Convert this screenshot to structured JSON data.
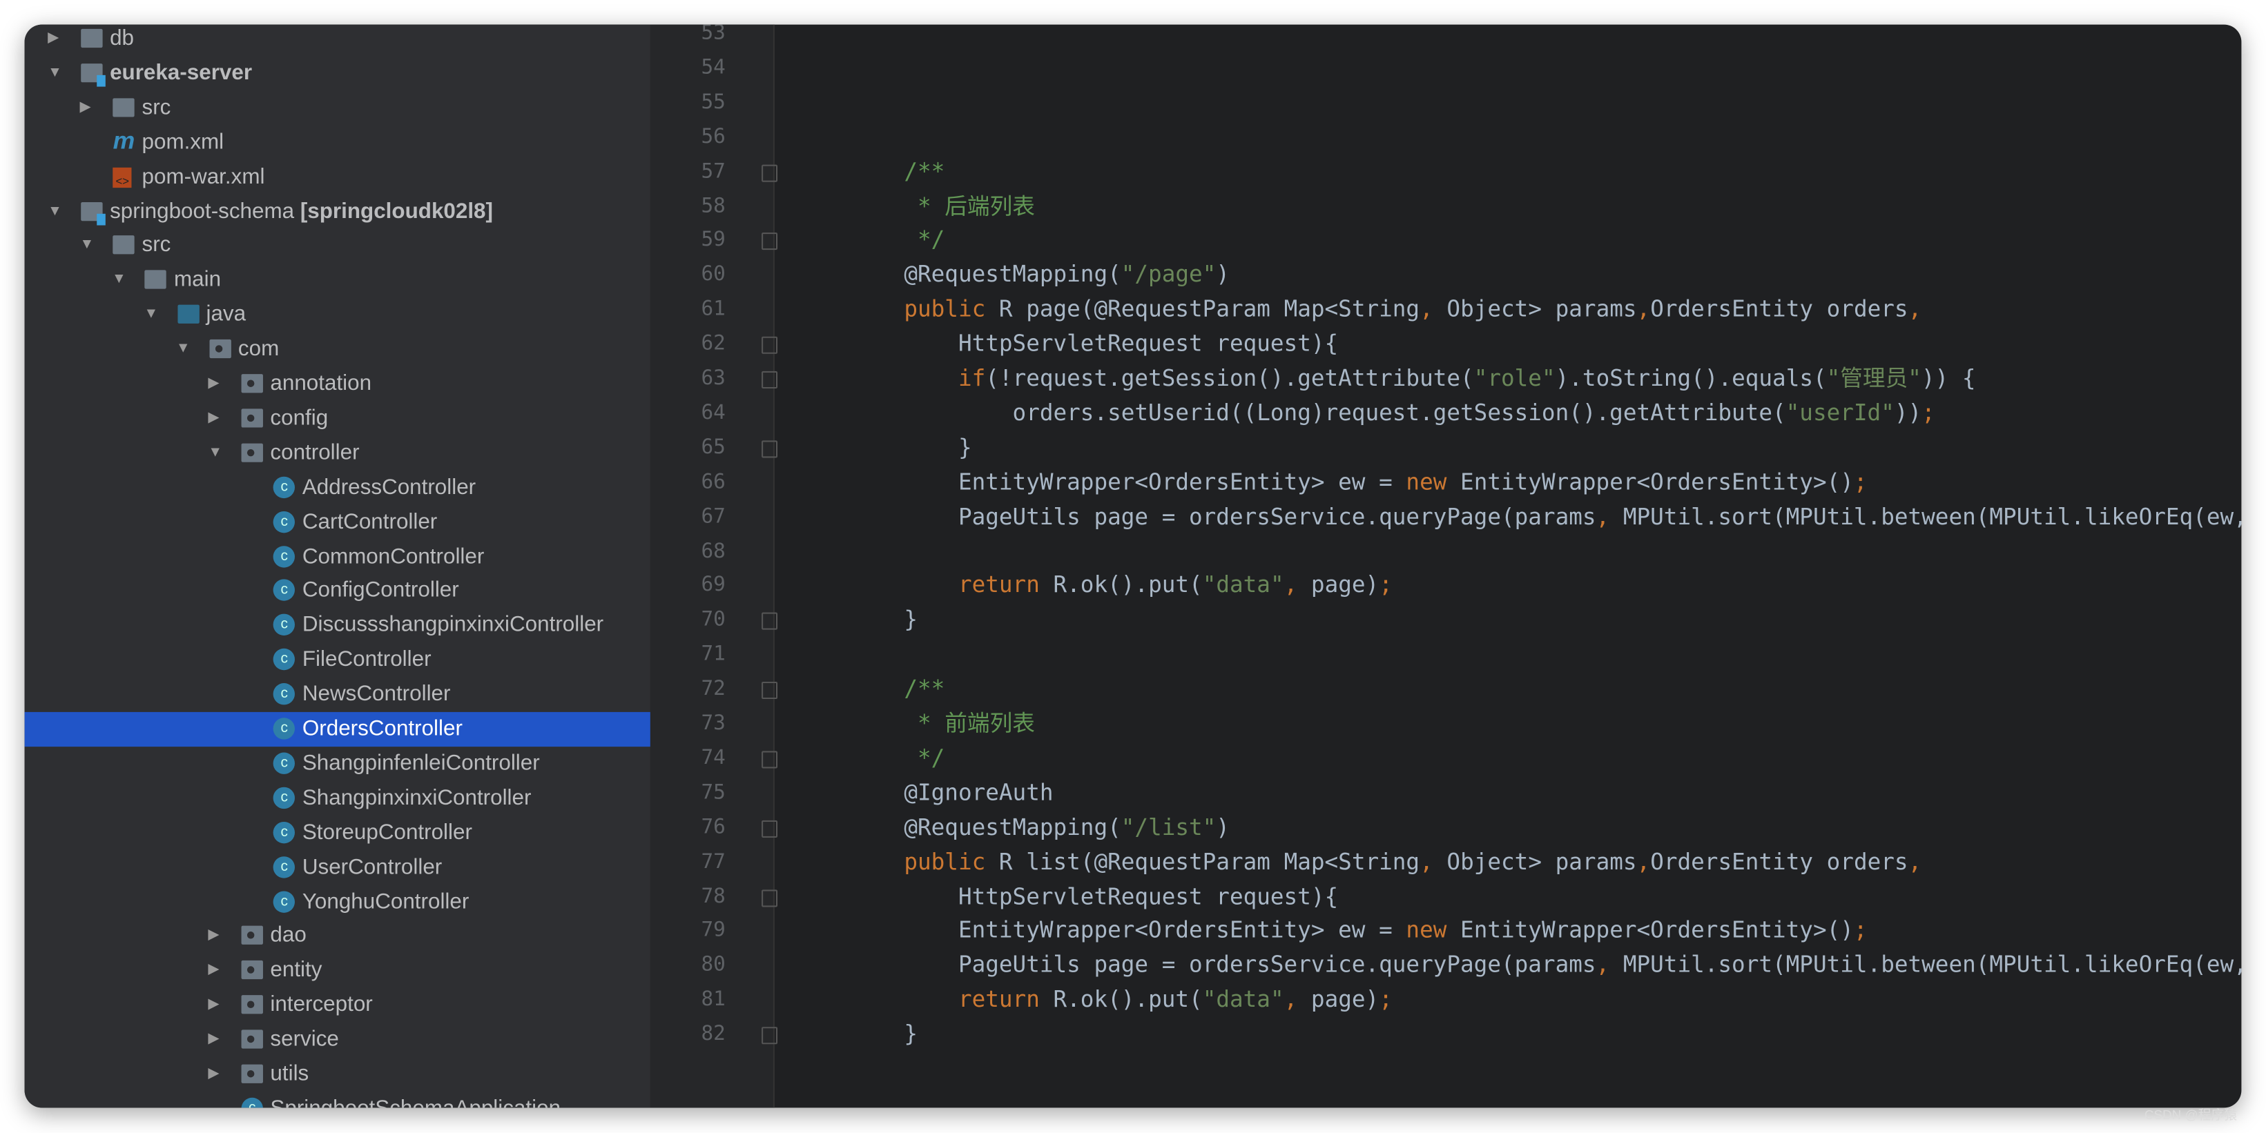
{
  "sidebar": {
    "items": [
      {
        "label": "db",
        "level": 0,
        "arrow": "right",
        "icon": "folder-icon"
      },
      {
        "label": "eureka-server",
        "level": 0,
        "arrow": "down",
        "icon": "module-folder-icon",
        "bold": true
      },
      {
        "label": "src",
        "level": 1,
        "arrow": "right",
        "icon": "folder-icon"
      },
      {
        "label": "pom.xml",
        "level": 1,
        "arrow": "none",
        "icon": "maven-icon"
      },
      {
        "label": "pom-war.xml",
        "level": 1,
        "arrow": "none",
        "icon": "xml-file-icon"
      },
      {
        "label": "springboot-schema",
        "suffix": "[springcloudk02l8]",
        "level": 0,
        "arrow": "down",
        "icon": "module-folder-icon"
      },
      {
        "label": "src",
        "level": 1,
        "arrow": "down",
        "icon": "folder-icon"
      },
      {
        "label": "main",
        "level": 2,
        "arrow": "down",
        "icon": "folder-icon"
      },
      {
        "label": "java",
        "level": 3,
        "arrow": "down",
        "icon": "source-folder-icon"
      },
      {
        "label": "com",
        "level": 4,
        "arrow": "down",
        "icon": "package-icon"
      },
      {
        "label": "annotation",
        "level": 5,
        "arrow": "right",
        "icon": "package-icon"
      },
      {
        "label": "config",
        "level": 5,
        "arrow": "right",
        "icon": "package-icon"
      },
      {
        "label": "controller",
        "level": 5,
        "arrow": "down",
        "icon": "package-icon"
      },
      {
        "label": "AddressController",
        "level": 6,
        "arrow": "none",
        "icon": "class-icon"
      },
      {
        "label": "CartController",
        "level": 6,
        "arrow": "none",
        "icon": "class-icon"
      },
      {
        "label": "CommonController",
        "level": 6,
        "arrow": "none",
        "icon": "class-icon"
      },
      {
        "label": "ConfigController",
        "level": 6,
        "arrow": "none",
        "icon": "class-icon"
      },
      {
        "label": "DiscussshangpinxinxiController",
        "level": 6,
        "arrow": "none",
        "icon": "class-icon"
      },
      {
        "label": "FileController",
        "level": 6,
        "arrow": "none",
        "icon": "class-icon"
      },
      {
        "label": "NewsController",
        "level": 6,
        "arrow": "none",
        "icon": "class-icon"
      },
      {
        "label": "OrdersController",
        "level": 6,
        "arrow": "none",
        "icon": "class-icon",
        "selected": true
      },
      {
        "label": "ShangpinfenleiController",
        "level": 6,
        "arrow": "none",
        "icon": "class-icon"
      },
      {
        "label": "ShangpinxinxiController",
        "level": 6,
        "arrow": "none",
        "icon": "class-icon"
      },
      {
        "label": "StoreupController",
        "level": 6,
        "arrow": "none",
        "icon": "class-icon"
      },
      {
        "label": "UserController",
        "level": 6,
        "arrow": "none",
        "icon": "class-icon"
      },
      {
        "label": "YonghuController",
        "level": 6,
        "arrow": "none",
        "icon": "class-icon"
      },
      {
        "label": "dao",
        "level": 5,
        "arrow": "right",
        "icon": "package-icon"
      },
      {
        "label": "entity",
        "level": 5,
        "arrow": "right",
        "icon": "package-icon"
      },
      {
        "label": "interceptor",
        "level": 5,
        "arrow": "right",
        "icon": "package-icon"
      },
      {
        "label": "service",
        "level": 5,
        "arrow": "right",
        "icon": "package-icon"
      },
      {
        "label": "utils",
        "level": 5,
        "arrow": "right",
        "icon": "package-icon"
      },
      {
        "label": "SpringbootSchemaApplication",
        "level": 5,
        "arrow": "none",
        "icon": "class-icon"
      }
    ]
  },
  "editor": {
    "lines": [
      {
        "n": "53",
        "seg": []
      },
      {
        "n": "54",
        "seg": []
      },
      {
        "n": "55",
        "seg": []
      },
      {
        "n": "56",
        "seg": []
      },
      {
        "n": "57",
        "fold": true,
        "seg": [
          [
            "cm",
            "    /**"
          ]
        ]
      },
      {
        "n": "58",
        "seg": [
          [
            "cm",
            "     * 后端列表"
          ]
        ]
      },
      {
        "n": "59",
        "fold": true,
        "seg": [
          [
            "cm",
            "     */"
          ]
        ]
      },
      {
        "n": "60",
        "seg": [
          [
            "pl",
            "    @RequestMapping("
          ],
          [
            "st",
            "\"/page\""
          ],
          [
            "pl",
            ")"
          ]
        ]
      },
      {
        "n": "61",
        "seg": [
          [
            "kw",
            "    public "
          ],
          [
            "pl",
            "R page(@RequestParam Map<String"
          ],
          [
            "pu",
            ", "
          ],
          [
            "pl",
            "Object> params"
          ],
          [
            "pu",
            ","
          ],
          [
            "pl",
            "OrdersEntity orders"
          ],
          [
            "pu",
            ","
          ]
        ]
      },
      {
        "n": "62",
        "fold": true,
        "seg": [
          [
            "pl",
            "        HttpServletRequest request){"
          ]
        ]
      },
      {
        "n": "63",
        "fold": true,
        "seg": [
          [
            "kw",
            "        if"
          ],
          [
            "pl",
            "(!request.getSession().getAttribute("
          ],
          [
            "st",
            "\"role\""
          ],
          [
            "pl",
            ").toString().equals("
          ],
          [
            "st",
            "\"管理员\""
          ],
          [
            "pl",
            ")) {"
          ]
        ]
      },
      {
        "n": "64",
        "seg": [
          [
            "pl",
            "            orders.setUserid((Long)request.getSession().getAttribute("
          ],
          [
            "st",
            "\"userId\""
          ],
          [
            "pl",
            "))"
          ],
          [
            "pu",
            ";"
          ]
        ]
      },
      {
        "n": "65",
        "fold": true,
        "seg": [
          [
            "pl",
            "        }"
          ]
        ]
      },
      {
        "n": "66",
        "seg": [
          [
            "pl",
            "        EntityWrapper<OrdersEntity> ew = "
          ],
          [
            "kw",
            "new "
          ],
          [
            "pl",
            "EntityWrapper<OrdersEntity>()"
          ],
          [
            "pu",
            ";"
          ]
        ]
      },
      {
        "n": "67",
        "seg": [
          [
            "pl",
            "        PageUtils page = ordersService.queryPage(params"
          ],
          [
            "pu",
            ", "
          ],
          [
            "pl",
            "MPUtil.sort(MPUtil.between(MPUtil.likeOrEq(ew, orders), params), params))"
          ],
          [
            "pu",
            ";"
          ]
        ]
      },
      {
        "n": "68",
        "seg": []
      },
      {
        "n": "69",
        "seg": [
          [
            "kw",
            "        return "
          ],
          [
            "pl",
            "R.ok().put("
          ],
          [
            "st",
            "\"data\""
          ],
          [
            "pu",
            ", "
          ],
          [
            "pl",
            "page)"
          ],
          [
            "pu",
            ";"
          ]
        ]
      },
      {
        "n": "70",
        "fold": true,
        "seg": [
          [
            "pl",
            "    }"
          ]
        ]
      },
      {
        "n": "71",
        "seg": []
      },
      {
        "n": "72",
        "fold": true,
        "seg": [
          [
            "cm",
            "    /**"
          ]
        ]
      },
      {
        "n": "73",
        "seg": [
          [
            "cm",
            "     * 前端列表"
          ]
        ]
      },
      {
        "n": "74",
        "fold": true,
        "seg": [
          [
            "cm",
            "     */"
          ]
        ]
      },
      {
        "n": "75",
        "seg": [
          [
            "pl",
            "    @IgnoreAuth"
          ]
        ]
      },
      {
        "n": "76",
        "fold": true,
        "seg": [
          [
            "pl",
            "    @RequestMapping("
          ],
          [
            "st",
            "\"/list\""
          ],
          [
            "pl",
            ")"
          ]
        ]
      },
      {
        "n": "77",
        "seg": [
          [
            "kw",
            "    public "
          ],
          [
            "pl",
            "R list(@RequestParam Map<String"
          ],
          [
            "pu",
            ", "
          ],
          [
            "pl",
            "Object> params"
          ],
          [
            "pu",
            ","
          ],
          [
            "pl",
            "OrdersEntity orders"
          ],
          [
            "pu",
            ","
          ]
        ]
      },
      {
        "n": "78",
        "fold": true,
        "seg": [
          [
            "pl",
            "        HttpServletRequest request){"
          ]
        ]
      },
      {
        "n": "79",
        "seg": [
          [
            "pl",
            "        EntityWrapper<OrdersEntity> ew = "
          ],
          [
            "kw",
            "new "
          ],
          [
            "pl",
            "EntityWrapper<OrdersEntity>()"
          ],
          [
            "pu",
            ";"
          ]
        ]
      },
      {
        "n": "80",
        "seg": [
          [
            "pl",
            "        PageUtils page = ordersService.queryPage(params"
          ],
          [
            "pu",
            ", "
          ],
          [
            "pl",
            "MPUtil.sort(MPUtil.between(MPUtil.likeOrEq(ew, orders), params), params))"
          ],
          [
            "pu",
            ";"
          ]
        ]
      },
      {
        "n": "81",
        "seg": [
          [
            "kw",
            "        return "
          ],
          [
            "pl",
            "R.ok().put("
          ],
          [
            "st",
            "\"data\""
          ],
          [
            "pu",
            ", "
          ],
          [
            "pl",
            "page)"
          ],
          [
            "pu",
            ";"
          ]
        ]
      },
      {
        "n": "82",
        "fold": true,
        "seg": [
          [
            "pl",
            "    }"
          ]
        ]
      }
    ]
  },
  "colors": {
    "keyword": "#cc7832",
    "string": "#6a8759",
    "comment": "#629755",
    "text": "#a9b7c6",
    "selection": "#2155c8"
  },
  "watermark": "CSDN @程序猿"
}
